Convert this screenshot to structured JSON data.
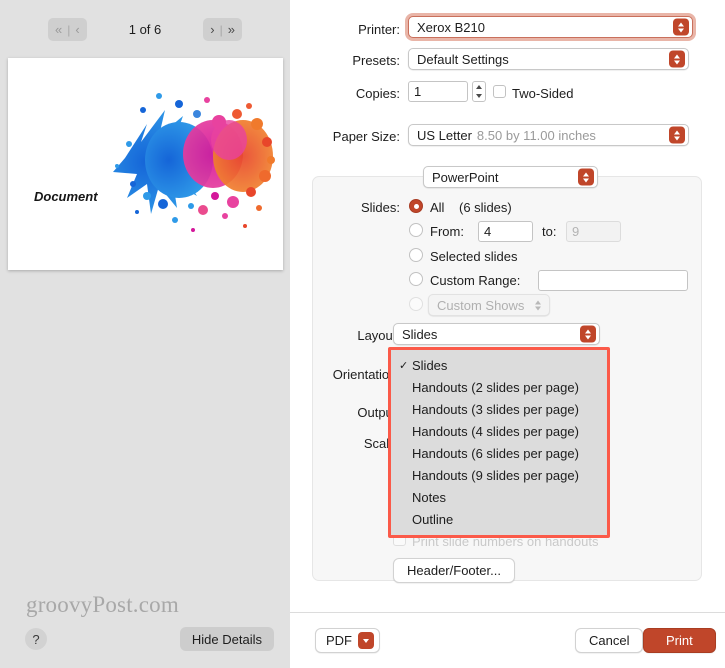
{
  "preview": {
    "nav": {
      "first_label": "«",
      "prev_label": "‹",
      "sep": "|",
      "next_label": "›",
      "last_label": "»",
      "page_indicator": "1 of 6"
    },
    "slide_label": "Document",
    "watermark": "groovyPost.com",
    "help_label": "?",
    "hide_details_label": "Hide Details"
  },
  "settings": {
    "printer": {
      "label": "Printer:",
      "value": "Xerox B210"
    },
    "presets": {
      "label": "Presets:",
      "value": "Default Settings"
    },
    "copies": {
      "label": "Copies:",
      "value": "1"
    },
    "two_sided": {
      "label": "Two-Sided",
      "checked": false
    },
    "paper_size": {
      "label": "Paper Size:",
      "value": "US Letter",
      "dimensions": "8.50 by 11.00 inches"
    },
    "app_selector": {
      "value": "PowerPoint"
    },
    "slides": {
      "label": "Slides:",
      "options": [
        {
          "label": "All",
          "extra": "(6 slides)",
          "selected": true
        },
        {
          "label": "From:",
          "from_value": "4",
          "to_label": "to:",
          "to_value": "9",
          "selected": false
        },
        {
          "label": "Selected slides",
          "selected": false
        },
        {
          "label": "Custom Range:",
          "range_value": "",
          "selected": false
        },
        {
          "label": "Custom Shows",
          "selected": false,
          "disabled": true
        }
      ]
    },
    "layout": {
      "label": "Layout:",
      "value": "Slides"
    },
    "orientation": {
      "label": "Orientation:"
    },
    "output": {
      "label": "Output:"
    },
    "scale": {
      "label": "Scale:"
    },
    "print_slide_numbers": {
      "label": "Print slide numbers on handouts",
      "checked": false
    },
    "header_footer": {
      "label": "Header/Footer..."
    }
  },
  "layout_menu": {
    "items": [
      {
        "label": "Slides",
        "checked": true
      },
      {
        "label": "Handouts (2 slides per page)",
        "checked": false
      },
      {
        "label": "Handouts (3 slides per page)",
        "checked": false
      },
      {
        "label": "Handouts (4 slides per page)",
        "checked": false
      },
      {
        "label": "Handouts (6 slides per page)",
        "checked": false
      },
      {
        "label": "Handouts (9 slides per page)",
        "checked": false
      },
      {
        "label": "Notes",
        "checked": false
      },
      {
        "label": "Outline",
        "checked": false
      }
    ],
    "check_glyph": "✓"
  },
  "footer": {
    "pdf_label": "PDF",
    "cancel_label": "Cancel",
    "print_label": "Print"
  },
  "colors": {
    "accent": "#c0462a",
    "highlight_ring": "#d77860",
    "menu_highlight_border": "#fb5a49",
    "panel_bg": "#e1e1e1"
  }
}
